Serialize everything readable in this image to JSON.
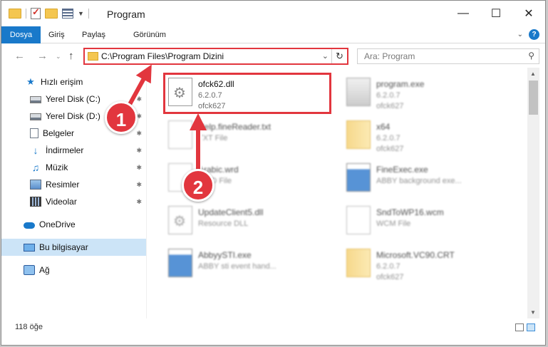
{
  "window": {
    "title": "Program"
  },
  "ribbon": {
    "tabs": [
      "Dosya",
      "Giriş",
      "Paylaş",
      "Görünüm"
    ]
  },
  "address": {
    "path": "C:\\Program Files\\Program Dizini",
    "search_placeholder": "Ara: Program"
  },
  "sidebar": {
    "items": [
      {
        "label": "Hızlı erişim",
        "icon": "star-icon"
      },
      {
        "label": "Yerel Disk (C:)",
        "icon": "disk-icon"
      },
      {
        "label": "Yerel Disk (D:)",
        "icon": "disk-icon"
      },
      {
        "label": "Belgeler",
        "icon": "documents-icon"
      },
      {
        "label": "İndirmeler",
        "icon": "download-icon"
      },
      {
        "label": "Müzik",
        "icon": "music-icon"
      },
      {
        "label": "Resimler",
        "icon": "pictures-icon"
      },
      {
        "label": "Videolar",
        "icon": "videos-icon"
      },
      {
        "label": "OneDrive",
        "icon": "cloud-icon"
      },
      {
        "label": "Bu bilgisayar",
        "icon": "computer-icon"
      },
      {
        "label": "Ağ",
        "icon": "network-icon"
      }
    ]
  },
  "files": [
    {
      "name": "ofck62.dll",
      "line1": "6.2.0.7",
      "line2": "ofck627",
      "icon": "dll-icon"
    },
    {
      "name": "program.exe",
      "line1": "6.2.0.7",
      "line2": "ofck627",
      "icon": "exe-icon"
    },
    {
      "name": "Help.fineReader.txt",
      "line1": "TXT File",
      "line2": "",
      "icon": "text-file-icon"
    },
    {
      "name": "x64",
      "line1": "6.2.0.7",
      "line2": "ofck627",
      "icon": "folder-icon"
    },
    {
      "name": "Arabic.wrd",
      "line1": "WRD File",
      "line2": "",
      "icon": "file-icon"
    },
    {
      "name": "FineExec.exe",
      "line1": "ABBY background exe...",
      "line2": "",
      "icon": "app-icon"
    },
    {
      "name": "UpdateClient5.dll",
      "line1": "Resource DLL",
      "line2": "",
      "icon": "dll-icon"
    },
    {
      "name": "SndToWP16.wcm",
      "line1": "WCM File",
      "line2": "",
      "icon": "file-icon"
    },
    {
      "name": "AbbyySTI.exe",
      "line1": "ABBY sti event hand...",
      "line2": "",
      "icon": "app-icon"
    },
    {
      "name": "Microsoft.VC90.CRT",
      "line1": "6.2.0.7",
      "line2": "ofck627",
      "icon": "folder-icon"
    }
  ],
  "status": {
    "count": "118 öğe"
  },
  "annotations": {
    "step1": "1",
    "step2": "2"
  },
  "colors": {
    "accent": "#1979ca",
    "highlight": "#e2363e",
    "selected_nav": "#cce4f7"
  }
}
